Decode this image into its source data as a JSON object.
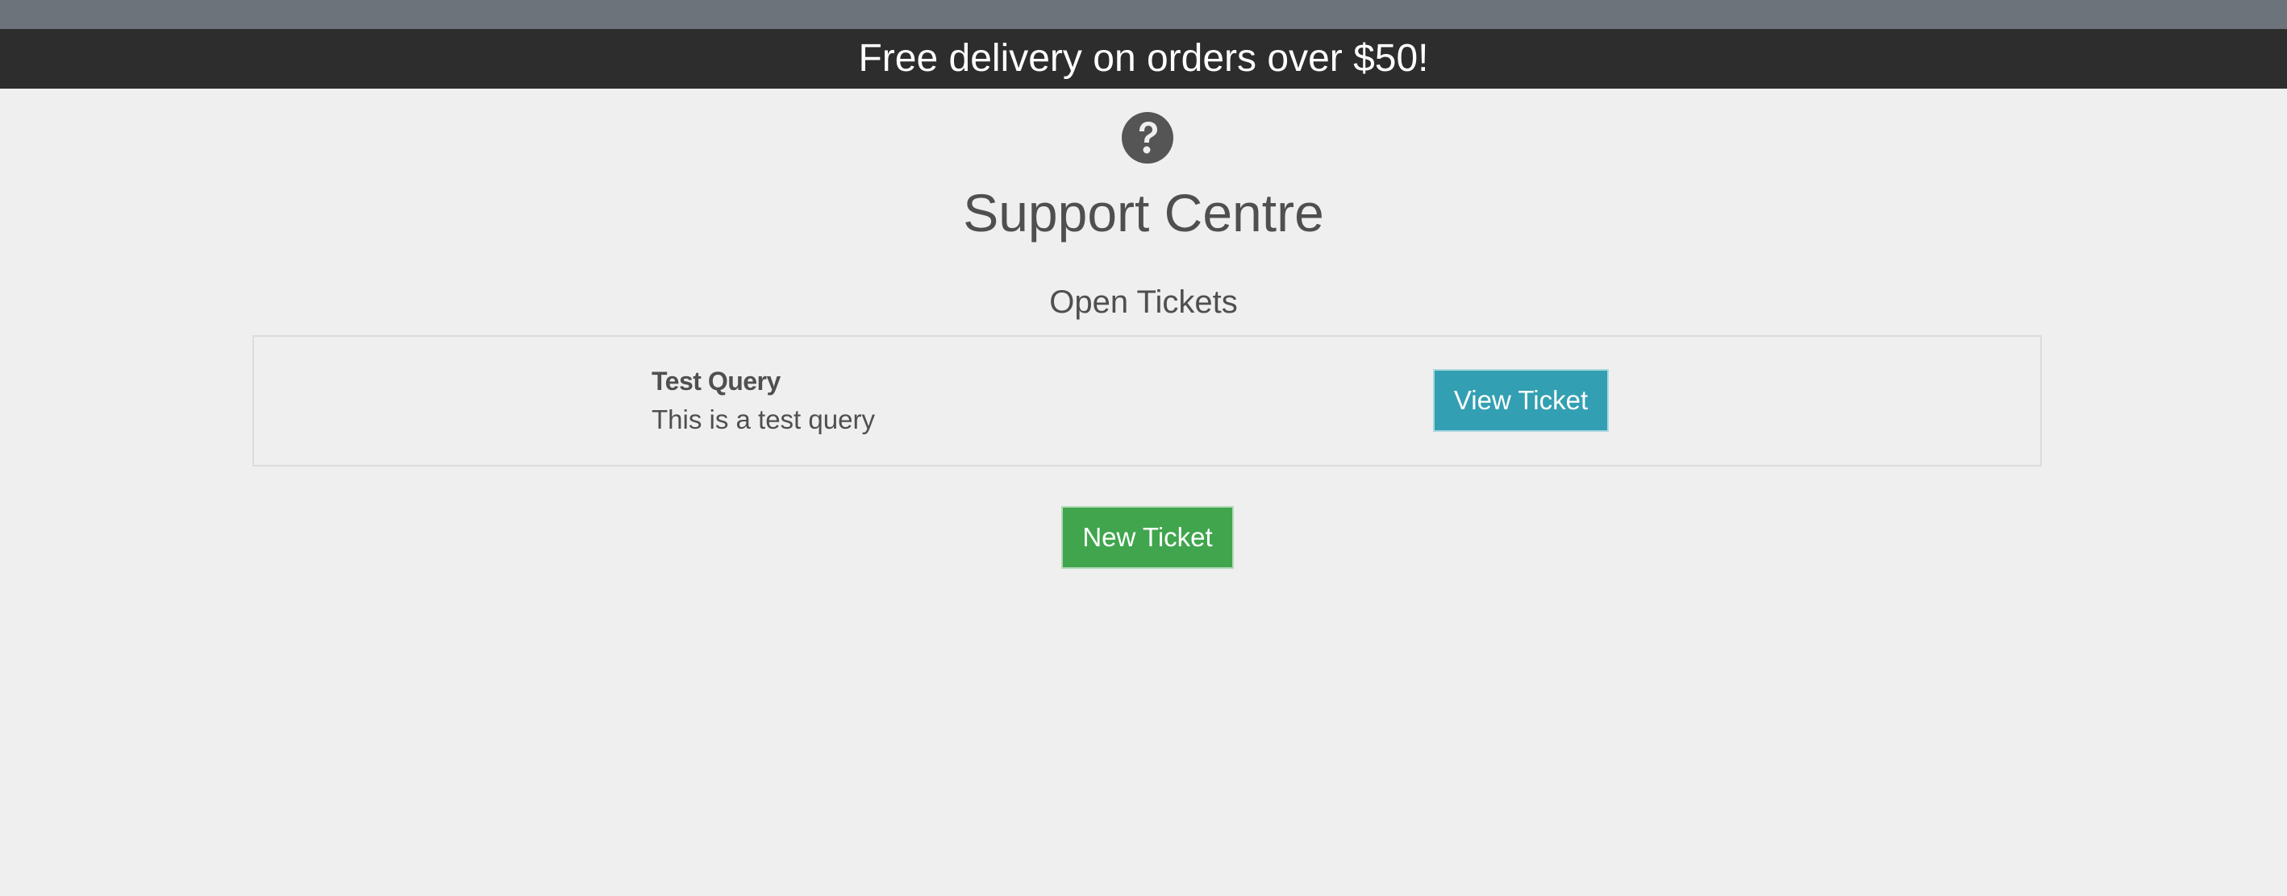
{
  "promo": {
    "text": "Free delivery on orders over $50!"
  },
  "header": {
    "icon": "question-circle-icon",
    "title": "Support Centre"
  },
  "tickets": {
    "section_title": "Open Tickets",
    "items": [
      {
        "subject": "Test Query",
        "description": "This is a test query",
        "action_label": "View Ticket"
      }
    ]
  },
  "actions": {
    "new_ticket_label": "New Ticket"
  },
  "colors": {
    "topbar": "#6c737b",
    "promo_bg": "#2d2d2d",
    "view_button": "#339fb2",
    "new_button": "#40a54d",
    "text": "#4f4f4f"
  }
}
